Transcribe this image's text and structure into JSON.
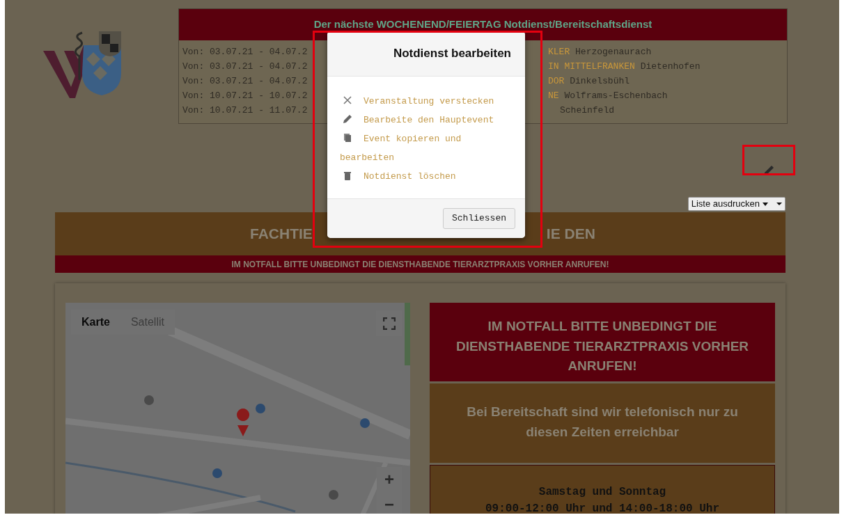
{
  "schedule": {
    "title": "Der nächste WOCHENEND/FEIERTAG Notdienst/Bereitschaftsdienst",
    "rows": [
      {
        "dates": "Von: 03.07.21 - 04.07.2",
        "name_part": "KLER",
        "place": "Herzogenaurach"
      },
      {
        "dates": "Von: 03.07.21 - 04.07.2",
        "name_part": "IN MITTELFRANKEN",
        "place": "Dietenhofen"
      },
      {
        "dates": "Von: 03.07.21 - 04.07.2",
        "name_part": "DOR",
        "place": "Dinkelsbühl"
      },
      {
        "dates": "Von: 10.07.21 - 10.07.2",
        "name_part": "NE",
        "place": "Wolframs-Eschenbach"
      },
      {
        "dates": "Von: 10.07.21 - 11.07.2",
        "place": "Scheinfeld"
      }
    ]
  },
  "print_select": {
    "value": "Liste ausdrucken"
  },
  "banner": {
    "left": "FACHTIE",
    "right": "IE DEN"
  },
  "notice_strip": "IM NOTFALL BITTE UNBEDINGT DIE DIENSTHABENDE TIERARZTPRAXIS VORHER ANRUFEN!",
  "map": {
    "map_types": [
      {
        "label": "Karte",
        "selected": true
      },
      {
        "label": "Satellit",
        "selected": false
      }
    ],
    "zoom_in": "+",
    "zoom_out": "−"
  },
  "info_boxes": [
    {
      "kind": "alert",
      "text": "IM NOTFALL BITTE UNBEDINGT DIE DIENSTHABENDE TIERARZTPRAXIS VORHER ANRUFEN!"
    },
    {
      "kind": "notice",
      "text": "Bei Bereitschaft sind wir telefonisch nur zu diesen Zeiten erreichbar"
    },
    {
      "kind": "hours",
      "lines": [
        "Samstag und Sonntag",
        "09:00-12:00 Uhr und 14:00-18:00 Uhr"
      ]
    }
  ],
  "modal": {
    "title": "Notdienst bearbeiten",
    "actions": [
      {
        "kind": "hide",
        "label": "Veranstaltung verstecken"
      },
      {
        "kind": "edit",
        "label": "Bearbeite den Hauptevent"
      },
      {
        "kind": "copy",
        "label": "Event kopieren und bearbeiten"
      },
      {
        "kind": "delete",
        "label": "Notdienst löschen"
      }
    ],
    "close_button": "Schliessen"
  }
}
